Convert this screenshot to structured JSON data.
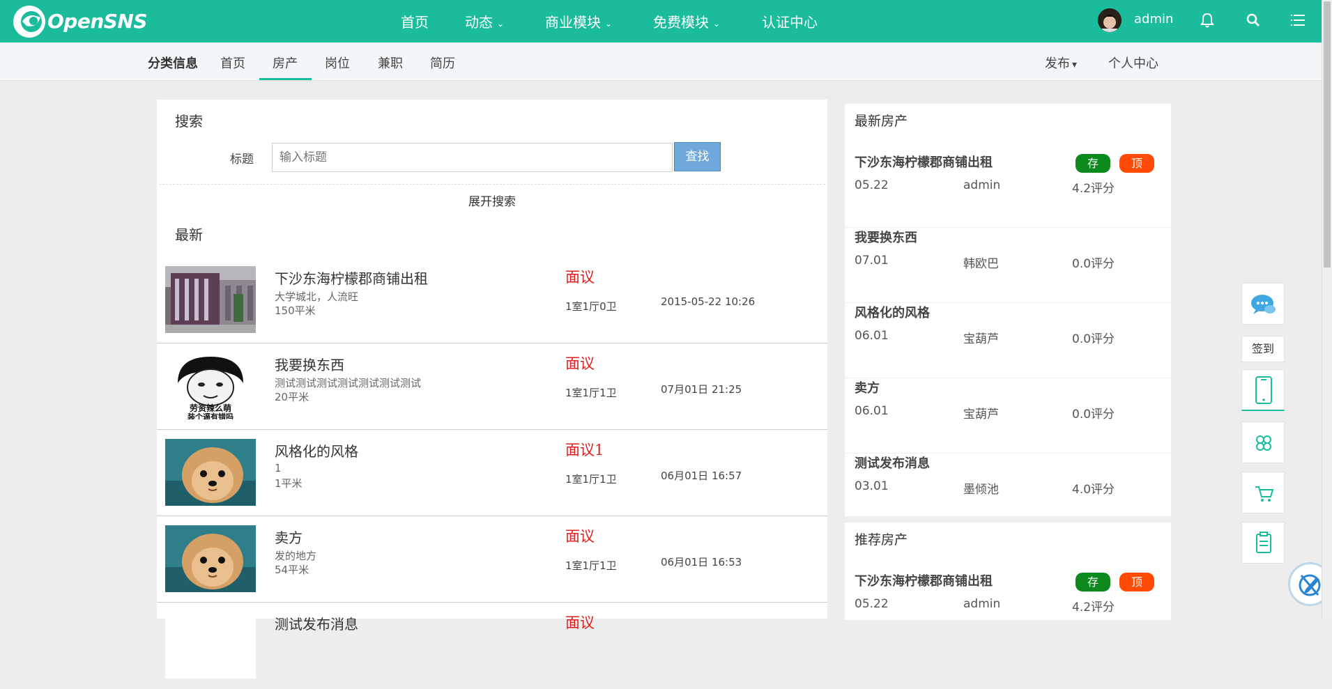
{
  "topnav": {
    "logo_text": "OpenSNS",
    "items": [
      {
        "label": "首页"
      },
      {
        "label": "动态",
        "caret": "⌄"
      },
      {
        "label": "商业模块",
        "caret": "⌄"
      },
      {
        "label": "免费模块",
        "caret": "⌄"
      },
      {
        "label": "认证中心"
      }
    ],
    "user": "admin",
    "icons": [
      "bell-icon",
      "search-icon",
      "menu-icon"
    ]
  },
  "subnav": {
    "brand": "分类信息",
    "items": [
      "首页",
      "房产",
      "岗位",
      "兼职",
      "简历"
    ],
    "active": "房产",
    "publish": "发布",
    "publish_caret": "▾",
    "personal_center": "个人中心"
  },
  "search": {
    "heading": "搜索",
    "title_label": "标题",
    "placeholder": "输入标题",
    "button": "查找",
    "expand": "展开搜索"
  },
  "latest": {
    "heading": "最新",
    "items": [
      {
        "title": "下沙东海柠檬郡商铺出租",
        "desc": "大学城北，人流旺",
        "area": "150平米",
        "price": "面议",
        "layout": "1室1厅0卫",
        "date": "2015-05-22 10:26",
        "thumb": "building-photo"
      },
      {
        "title": "我要换东西",
        "desc": "测试测试测试测试测试测试测试",
        "area": "20平米",
        "price": "面议",
        "layout": "1室1厅1卫",
        "date": "07月01日 21:25",
        "thumb": "meme-image"
      },
      {
        "title": "风格化的风格",
        "desc": "1",
        "area": "1平米",
        "price": "面议1",
        "layout": "1室1厅1卫",
        "date": "06月01日 16:57",
        "thumb": "dog-photo"
      },
      {
        "title": "卖方",
        "desc": "发的地方",
        "area": "54平米",
        "price": "面议",
        "layout": "1室1厅1卫",
        "date": "06月01日 16:53",
        "thumb": "dog-photo"
      },
      {
        "title": "测试发布消息",
        "desc": "",
        "area": "",
        "price": "面议",
        "layout": "",
        "date": "",
        "thumb": "meme-image"
      }
    ],
    "meme_caption_1": "劳资辣么萌",
    "meme_caption_2": "装个逼有错吗"
  },
  "side_latest": {
    "heading": "最新房产",
    "items": [
      {
        "title": "下沙东海柠檬郡商铺出租",
        "date": "05.22",
        "user": "admin",
        "score": "4.2评分",
        "badges": [
          "存",
          "顶"
        ]
      },
      {
        "title": "我要换东西",
        "date": "07.01",
        "user": "韩欧巴",
        "score": "0.0评分"
      },
      {
        "title": "风格化的风格",
        "date": "06.01",
        "user": "宝葫芦",
        "score": "0.0评分"
      },
      {
        "title": "卖方",
        "date": "06.01",
        "user": "宝葫芦",
        "score": "0.0评分"
      },
      {
        "title": "测试发布消息",
        "date": "03.01",
        "user": "墨倾池",
        "score": "4.0评分"
      }
    ]
  },
  "side_recommend": {
    "heading": "推荐房产",
    "items": [
      {
        "title": "下沙东海柠檬郡商铺出租",
        "date": "05.22",
        "user": "admin",
        "score": "4.2评分",
        "badges": [
          "存",
          "顶"
        ]
      }
    ]
  },
  "toolbar": {
    "signin": "签到",
    "icons": [
      "chat-icon",
      "phone-icon",
      "grid-icon",
      "cart-icon",
      "clipboard-icon"
    ]
  },
  "colors": {
    "brand": "#1abc9c",
    "price": "#e02020",
    "save_badge": "#0d8a1d",
    "top_badge": "#ff4a05",
    "search_button": "#6fa8dc"
  }
}
